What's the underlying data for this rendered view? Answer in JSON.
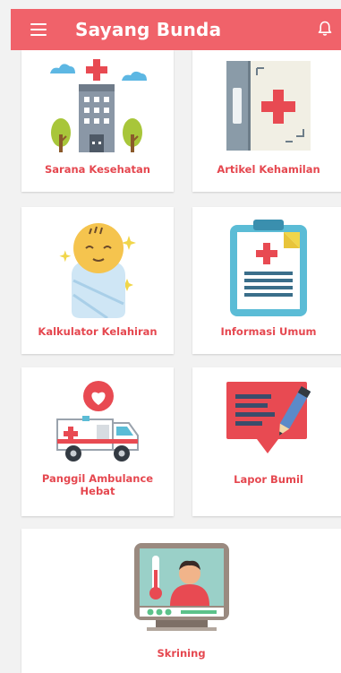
{
  "app": {
    "title": "Sayang Bunda",
    "menu_icon": "hamburger-menu-icon",
    "notification_icon": "bell-icon"
  },
  "colors": {
    "primary": "#f0626a",
    "label": "#e5474f",
    "background": "#f2f2f2",
    "card": "#ffffff"
  },
  "menu": [
    {
      "label": "Sarana Kesehatan",
      "icon": "hospital-icon"
    },
    {
      "label": "Artikel Kehamilan",
      "icon": "medical-folder-icon"
    },
    {
      "label": "Kalkulator Kelahiran",
      "icon": "baby-icon"
    },
    {
      "label": "Informasi Umum",
      "icon": "clipboard-icon"
    },
    {
      "label": "Panggil Ambulance Hebat",
      "icon": "ambulance-icon"
    },
    {
      "label": "Lapor Bumil",
      "icon": "report-message-icon"
    },
    {
      "label": "Skrining",
      "icon": "screening-monitor-icon"
    }
  ]
}
